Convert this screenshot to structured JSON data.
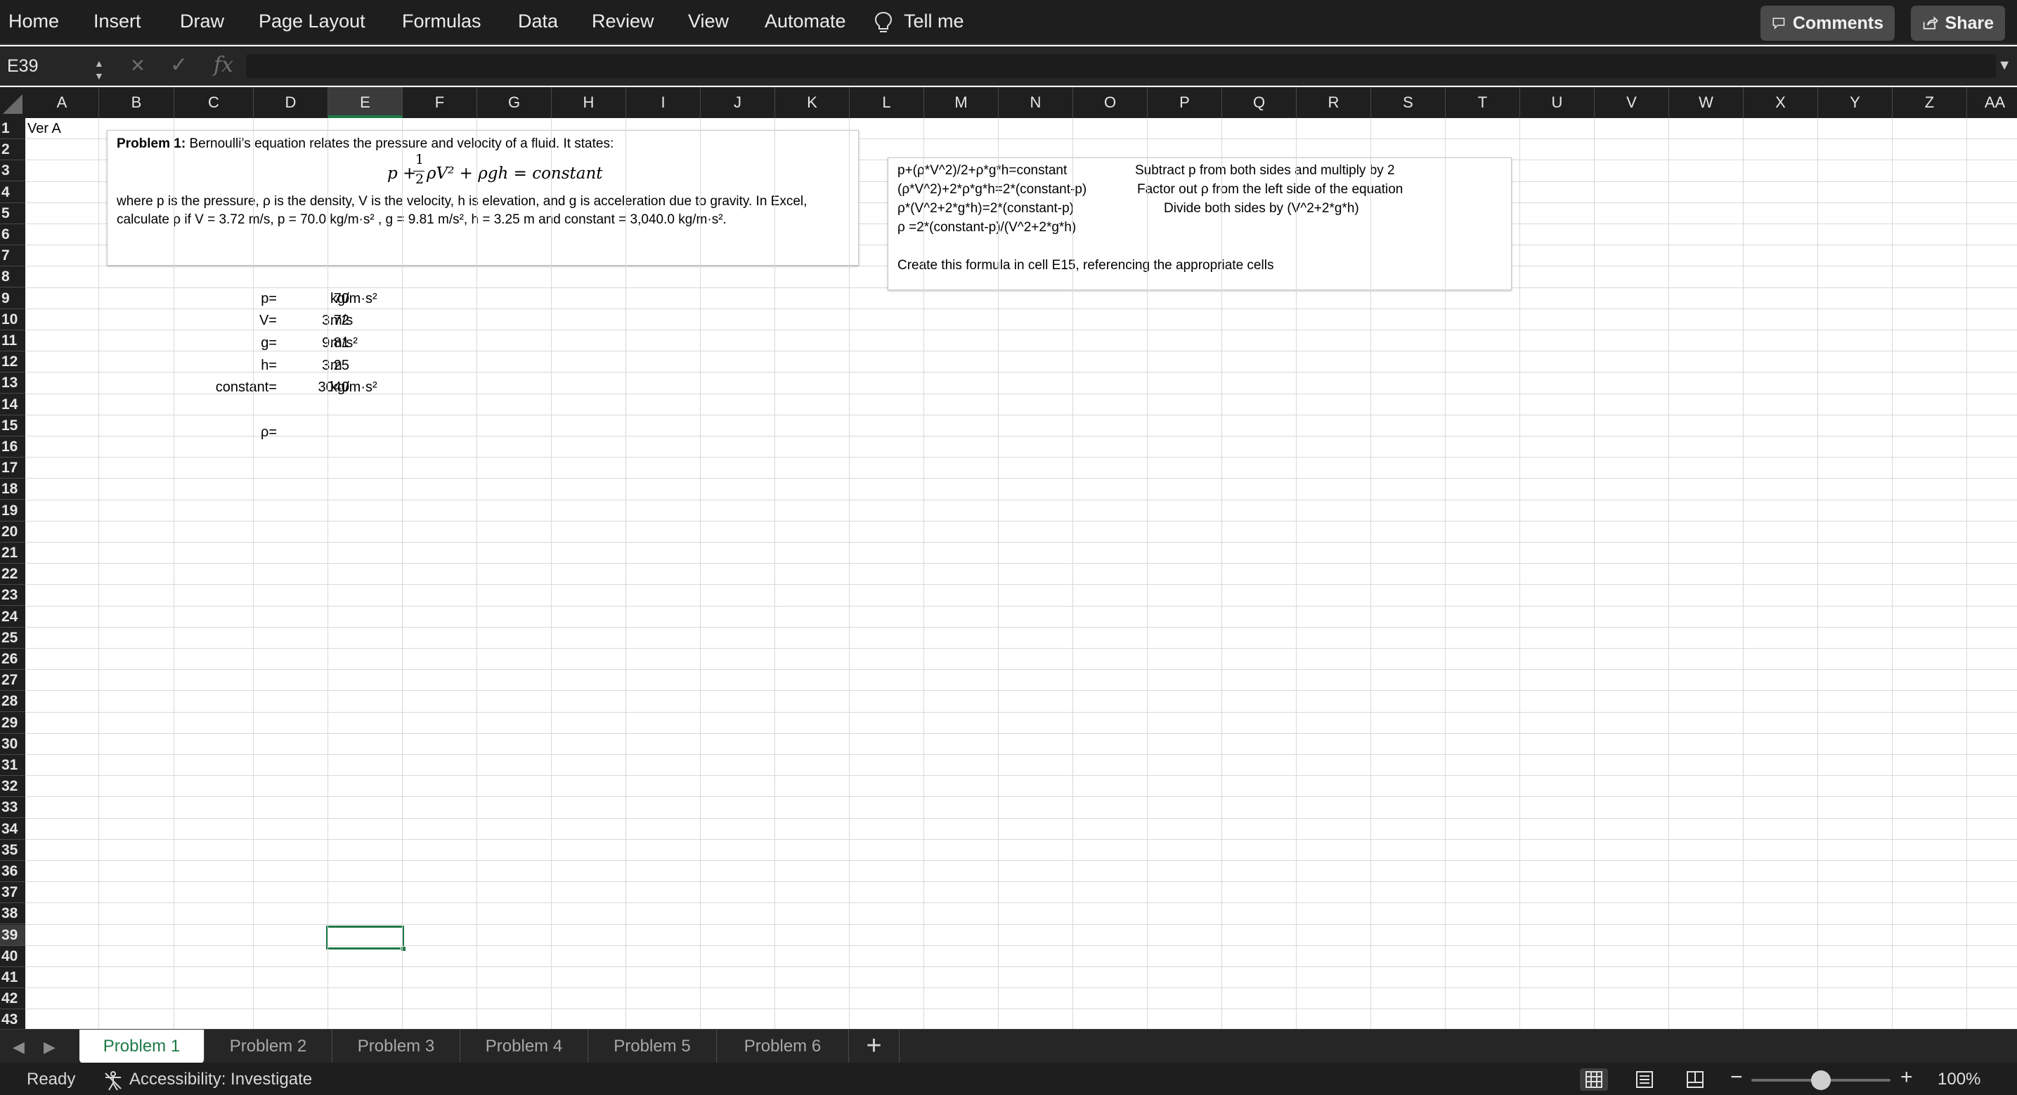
{
  "ribbon": {
    "tabs": [
      "Home",
      "Insert",
      "Draw",
      "Page Layout",
      "Formulas",
      "Data",
      "Review",
      "View",
      "Automate"
    ],
    "tell_me": "Tell me",
    "comments_label": "Comments",
    "share_label": "Share"
  },
  "formula_bar": {
    "name_box": "E39",
    "fx_label": "fx",
    "content": ""
  },
  "columns": [
    "A",
    "B",
    "C",
    "D",
    "E",
    "F",
    "G",
    "H",
    "I",
    "J",
    "K",
    "L",
    "M",
    "N",
    "O",
    "P",
    "Q",
    "R",
    "S",
    "T",
    "U",
    "V",
    "W",
    "X",
    "Y",
    "Z",
    "AA"
  ],
  "rows": [
    "1",
    "2",
    "3",
    "4",
    "5",
    "6",
    "7",
    "8",
    "9",
    "10",
    "11",
    "12",
    "13",
    "14",
    "15",
    "16",
    "17",
    "18",
    "19",
    "20",
    "21",
    "22",
    "23",
    "24",
    "25",
    "26",
    "27",
    "28",
    "29",
    "30",
    "31",
    "32",
    "33",
    "34",
    "35",
    "36",
    "37",
    "38",
    "39",
    "40",
    "41",
    "42",
    "43"
  ],
  "selected_cell": {
    "column": "E",
    "row": "39"
  },
  "cells": {
    "a1": "Ver A",
    "c9": "p=",
    "d9": "70",
    "e9": "kg/m·s²",
    "c10": "V=",
    "d10": "3.72",
    "e10": "m/s",
    "c11": "g=",
    "d11": "9.81",
    "e11": "m/s²",
    "c12": "h=",
    "d12": "3.25",
    "e12": "m",
    "c13": "constant=",
    "d13": "3040",
    "e13": "kg/m·s²",
    "c15": "ρ="
  },
  "problem_box": {
    "heading": "Problem 1:",
    "intro": " Bernoulli’s equation relates the pressure and velocity of a fluid.  It states:",
    "equation_left": "p +",
    "equation_num": "1",
    "equation_den": "2",
    "equation_right": "ρV² + ρgh = constant",
    "line1": "where p is the pressure, ρ is the density, V is the velocity, h is elevation, and g is acceleration due to gravity. In Excel,",
    "line2": "calculate ρ if V = 3.72 m/s, p = 70.0 kg/m·s² , g = 9.81 m/s², h = 3.25 m and constant = 3,040.0 kg/m·s²."
  },
  "hint_box": {
    "step1": "p+(ρ*V^2)/2+ρ*g*h=constant",
    "step2": "(ρ*V^2)+2*ρ*g*h=2*(constant-p)",
    "step3": "ρ*(V^2+2*g*h)=2*(constant-p)",
    "step4": "ρ =2*(constant-p)/(V^2+2*g*h)",
    "note1": "Subtract p from both sides and multiply by 2",
    "note2": "Factor out ρ from the left side of the equation",
    "note3": "Divide both sides by (V^2+2*g*h)",
    "instruction": "Create this formula in cell E15, referencing the appropriate cells"
  },
  "sheets": {
    "tabs": [
      "Problem 1",
      "Problem 2",
      "Problem 3",
      "Problem 4",
      "Problem 5",
      "Problem 6"
    ],
    "active": "Problem 1",
    "add_label": "+"
  },
  "status": {
    "ready": "Ready",
    "accessibility": "Accessibility: Investigate",
    "zoom": "100%",
    "zoom_fraction": 0.5
  },
  "colors": {
    "accent": "#1e7a46",
    "ribbon_bg": "#1e1e1e",
    "header_bg": "#1f1f1f",
    "gridline": "#d9d9d9"
  }
}
